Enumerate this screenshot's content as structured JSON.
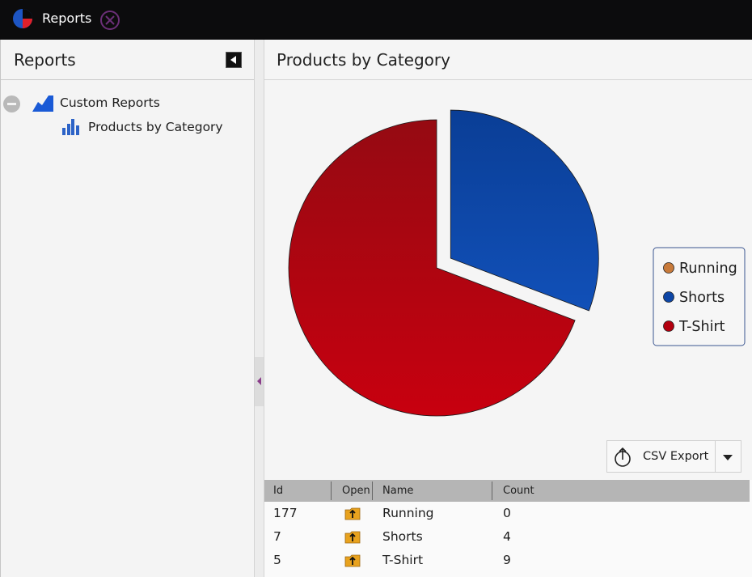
{
  "app": {
    "title": "Reports"
  },
  "left_panel": {
    "title": "Reports",
    "tree": {
      "folder_label": "Custom Reports",
      "report_label": "Products by Category"
    }
  },
  "main": {
    "title": "Products by Category",
    "csv_export_label": "CSV Export",
    "grid": {
      "columns": [
        "Id",
        "Open",
        "Name",
        "Count"
      ],
      "rows": [
        {
          "id": "177",
          "name": "Running",
          "count": "0"
        },
        {
          "id": "7",
          "name": "Shorts",
          "count": "4"
        },
        {
          "id": "5",
          "name": "T-Shirt",
          "count": "9"
        }
      ]
    }
  },
  "chart_data": {
    "type": "pie",
    "categories": [
      "Running",
      "Shorts",
      "T-Shirt"
    ],
    "values": [
      0,
      4,
      9
    ],
    "colors": [
      "#c87a3a",
      "#0d46a6",
      "#b3000f"
    ],
    "exploded": "Shorts",
    "legend_position": "right"
  }
}
